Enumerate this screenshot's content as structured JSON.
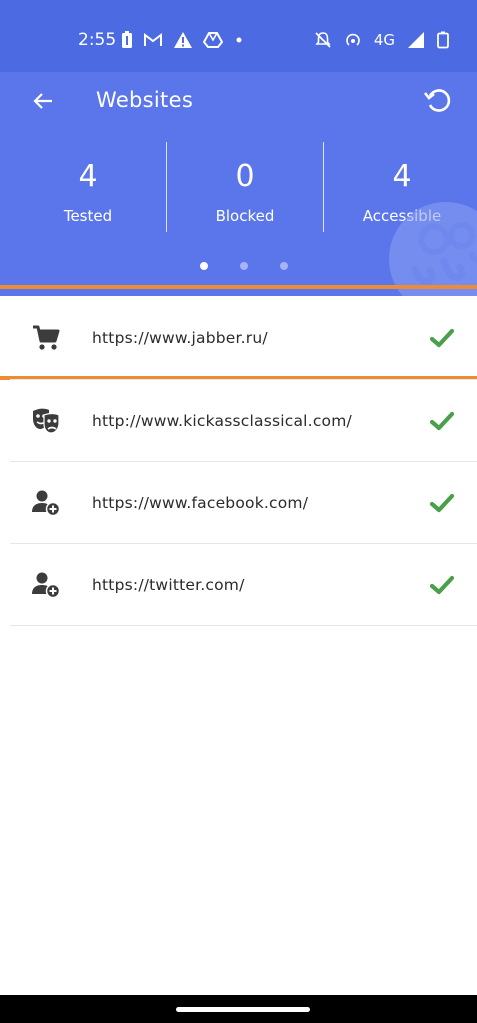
{
  "status_bar": {
    "time": "2:55",
    "network": "4G",
    "icons": [
      "battery-saver-icon",
      "gmail-icon",
      "warning-icon",
      "drive-icon",
      "dot-icon",
      "mute-icon",
      "hotspot-icon",
      "signal-icon",
      "battery-icon"
    ]
  },
  "header": {
    "title": "Websites",
    "back_icon": "arrow-back-icon",
    "refresh_icon": "refresh-icon"
  },
  "stats": [
    {
      "value": "4",
      "label": "Tested"
    },
    {
      "value": "0",
      "label": "Blocked"
    },
    {
      "value": "4",
      "label": "Accessible"
    }
  ],
  "pager": {
    "pages": 3,
    "active": 0
  },
  "websites": [
    {
      "url": "https://www.jabber.ru/",
      "icon": "shopping-cart-icon",
      "status": "accessible"
    },
    {
      "url": "http://www.kickassclassical.com/",
      "icon": "theater-masks-icon",
      "status": "accessible"
    },
    {
      "url": "https://www.facebook.com/",
      "icon": "user-plus-icon",
      "status": "accessible"
    },
    {
      "url": "https://twitter.com/",
      "icon": "user-plus-icon",
      "status": "accessible"
    }
  ],
  "colors": {
    "header": "#5b76ea",
    "status_bar": "#4c6be3",
    "check": "#4aa04a",
    "icon": "#3c3c3c",
    "highlight": "#ee8b35"
  }
}
